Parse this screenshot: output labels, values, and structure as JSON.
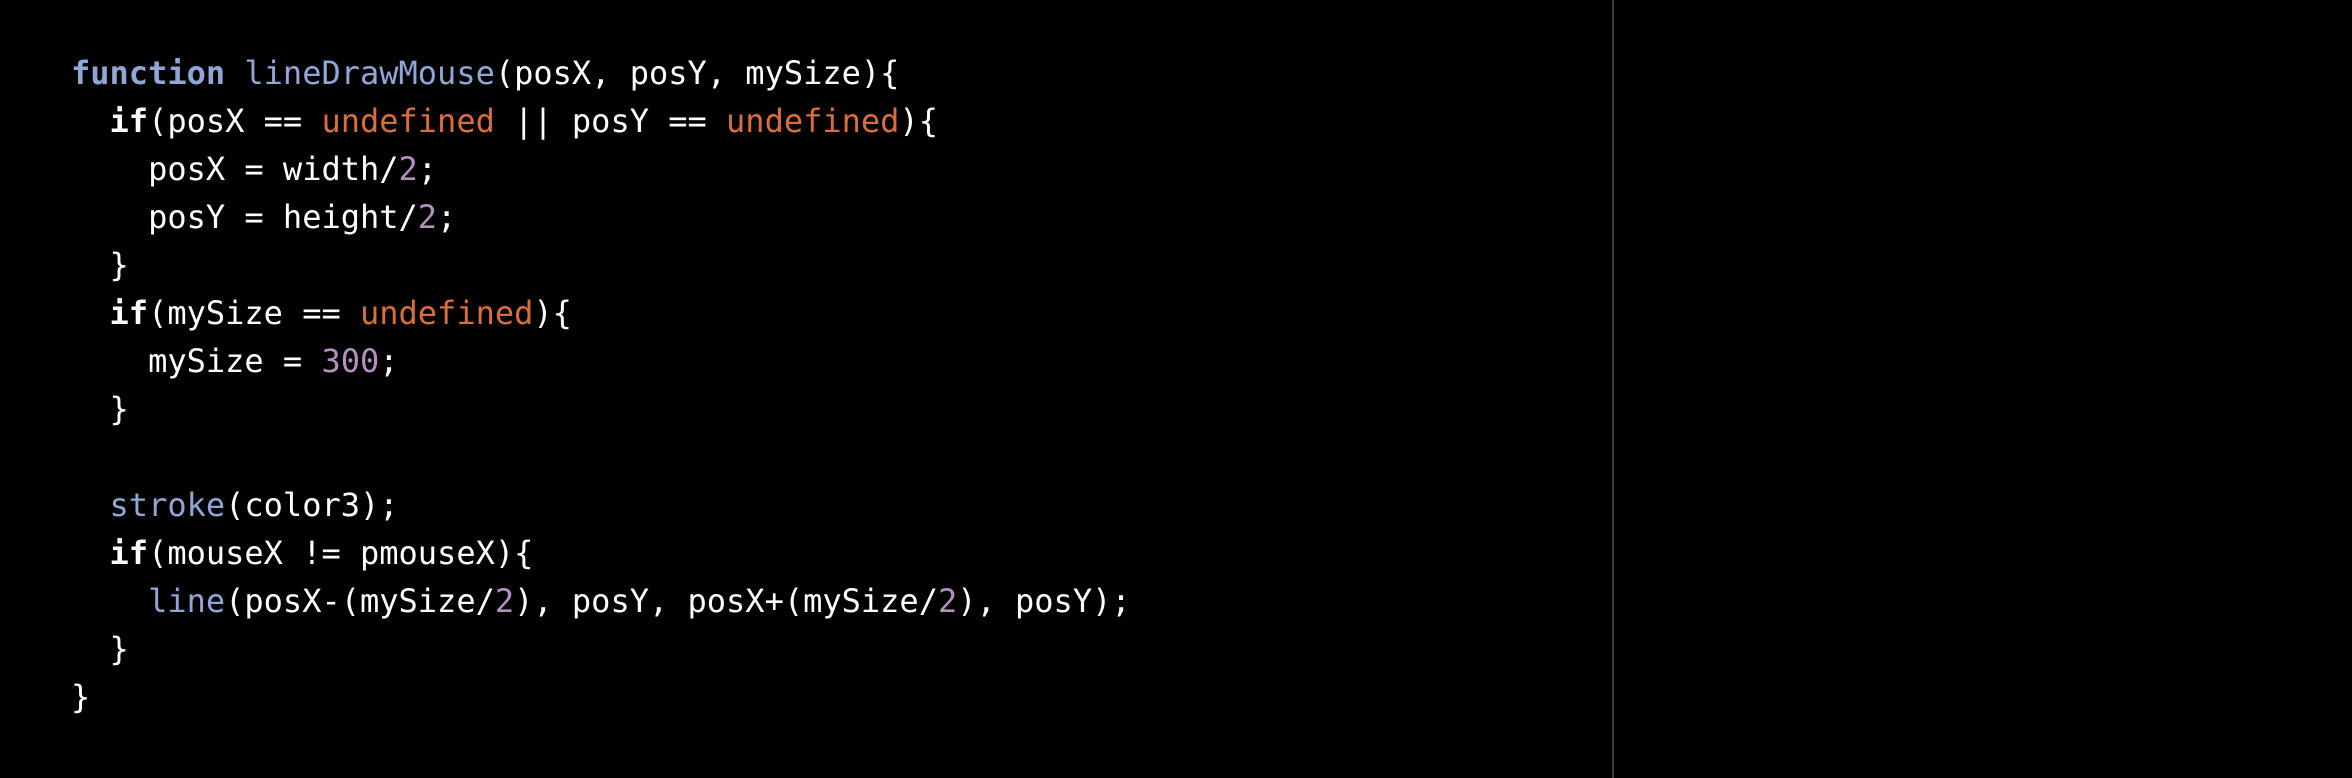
{
  "code": {
    "lines": [
      [
        {
          "t": "function",
          "c": "kw-fn"
        },
        {
          "t": " ",
          "c": "plain"
        },
        {
          "t": "lineDrawMouse",
          "c": "fn"
        },
        {
          "t": "(posX, posY, mySize){",
          "c": "plain"
        }
      ],
      [
        {
          "t": "  ",
          "c": "plain"
        },
        {
          "t": "if",
          "c": "kw"
        },
        {
          "t": "(posX == ",
          "c": "plain"
        },
        {
          "t": "undefined",
          "c": "undef"
        },
        {
          "t": " || posY == ",
          "c": "plain"
        },
        {
          "t": "undefined",
          "c": "undef"
        },
        {
          "t": "){",
          "c": "plain"
        }
      ],
      [
        {
          "t": "    posX = width/",
          "c": "plain"
        },
        {
          "t": "2",
          "c": "num"
        },
        {
          "t": ";",
          "c": "plain"
        }
      ],
      [
        {
          "t": "    posY = height/",
          "c": "plain"
        },
        {
          "t": "2",
          "c": "num"
        },
        {
          "t": ";",
          "c": "plain"
        }
      ],
      [
        {
          "t": "  }",
          "c": "plain"
        }
      ],
      [
        {
          "t": "  ",
          "c": "plain"
        },
        {
          "t": "if",
          "c": "kw"
        },
        {
          "t": "(mySize == ",
          "c": "plain"
        },
        {
          "t": "undefined",
          "c": "undef"
        },
        {
          "t": "){",
          "c": "plain"
        }
      ],
      [
        {
          "t": "    mySize = ",
          "c": "plain"
        },
        {
          "t": "300",
          "c": "num"
        },
        {
          "t": ";",
          "c": "plain"
        }
      ],
      [
        {
          "t": "  }",
          "c": "plain"
        }
      ],
      [
        {
          "t": "",
          "c": "plain"
        }
      ],
      [
        {
          "t": "  ",
          "c": "plain"
        },
        {
          "t": "stroke",
          "c": "fn"
        },
        {
          "t": "(color3);",
          "c": "plain"
        }
      ],
      [
        {
          "t": "  ",
          "c": "plain"
        },
        {
          "t": "if",
          "c": "kw"
        },
        {
          "t": "(mouseX != pmouseX){",
          "c": "plain"
        }
      ],
      [
        {
          "t": "    ",
          "c": "plain"
        },
        {
          "t": "line",
          "c": "fn"
        },
        {
          "t": "(posX-(mySize/",
          "c": "plain"
        },
        {
          "t": "2",
          "c": "num"
        },
        {
          "t": "), posY, posX+(mySize/",
          "c": "plain"
        },
        {
          "t": "2",
          "c": "num"
        },
        {
          "t": "), posY);",
          "c": "plain"
        }
      ],
      [
        {
          "t": "  }",
          "c": "plain"
        }
      ],
      [
        {
          "t": "}",
          "c": "plain"
        }
      ]
    ]
  },
  "colors": {
    "background": "#000000",
    "keyword_function": "#8fa6d6",
    "function_name": "#8fa6d6",
    "undefined": "#d96e3a",
    "number": "#b58fbf",
    "text": "#ffffff",
    "divider": "#3a3a3a"
  }
}
